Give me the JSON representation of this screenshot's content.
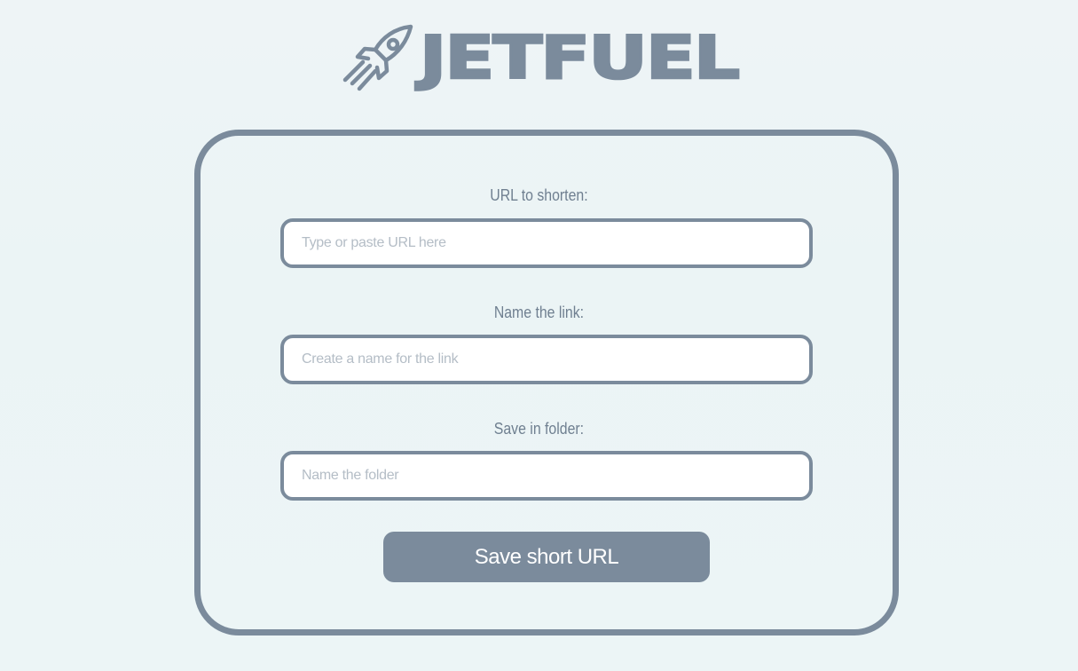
{
  "app": {
    "title": "JETFUEL",
    "logo_icon": "rocket-icon",
    "accent_color": "#7b8b9c"
  },
  "form": {
    "url": {
      "label": "URL to shorten:",
      "placeholder": "Type or paste URL here",
      "value": ""
    },
    "name": {
      "label": "Name the link:",
      "placeholder": "Create a name for the link",
      "value": ""
    },
    "folder": {
      "label": "Save in folder:",
      "placeholder": "Name the folder",
      "value": ""
    },
    "submit_label": "Save short URL"
  }
}
